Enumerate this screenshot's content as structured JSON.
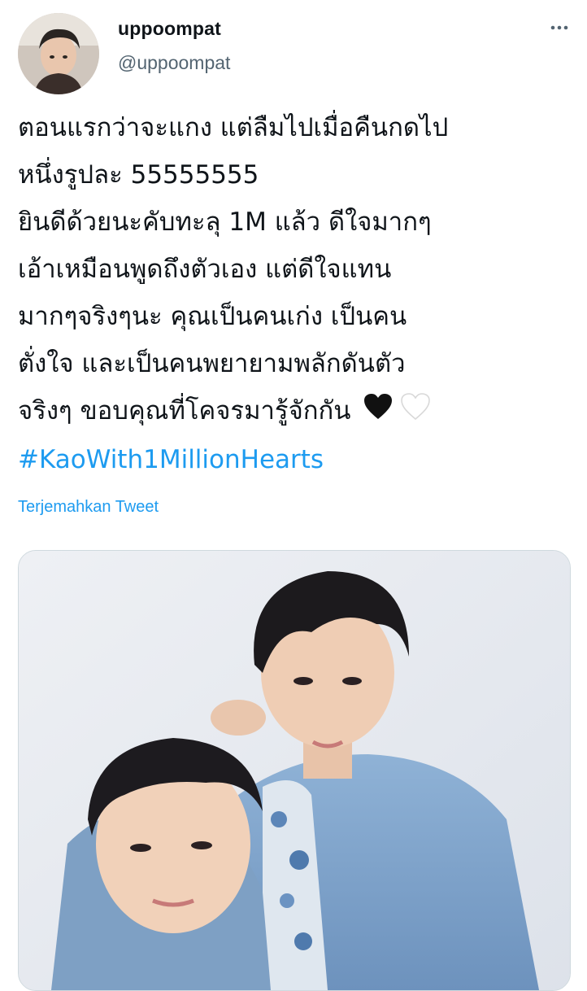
{
  "author": {
    "display_name": "uppoompat",
    "handle": "@uppoompat"
  },
  "icons": {
    "more": "more-dots-icon",
    "heart_black": "black-heart-emoji",
    "heart_white": "white-heart-emoji"
  },
  "tweet": {
    "lines": [
      "ตอนแรกว่าจะแกง แต่ลืมไปเมื่อคืนกดไป",
      "หนึ่งรูปละ 55555555",
      "ยินดีด้วยนะคับทะลุ 1M แล้ว ดีใจมากๆ",
      "เอ้าเหมือนพูดถึงตัวเอง แต่ดีใจแทน",
      "มากๆจริงๆนะ คุณเป็นคนเก่ง เป็นคน",
      "ตั่งใจ และเป็นคนพยายามพลักดันตัว",
      "จริงๆ ขอบคุณที่โคจรมารู้จักกัน"
    ],
    "hashtag": "#KaoWith1MillionHearts"
  },
  "translate_label": "Terjemahkan Tweet",
  "colors": {
    "link": "#1d9bf0",
    "secondary_text": "#536471"
  }
}
